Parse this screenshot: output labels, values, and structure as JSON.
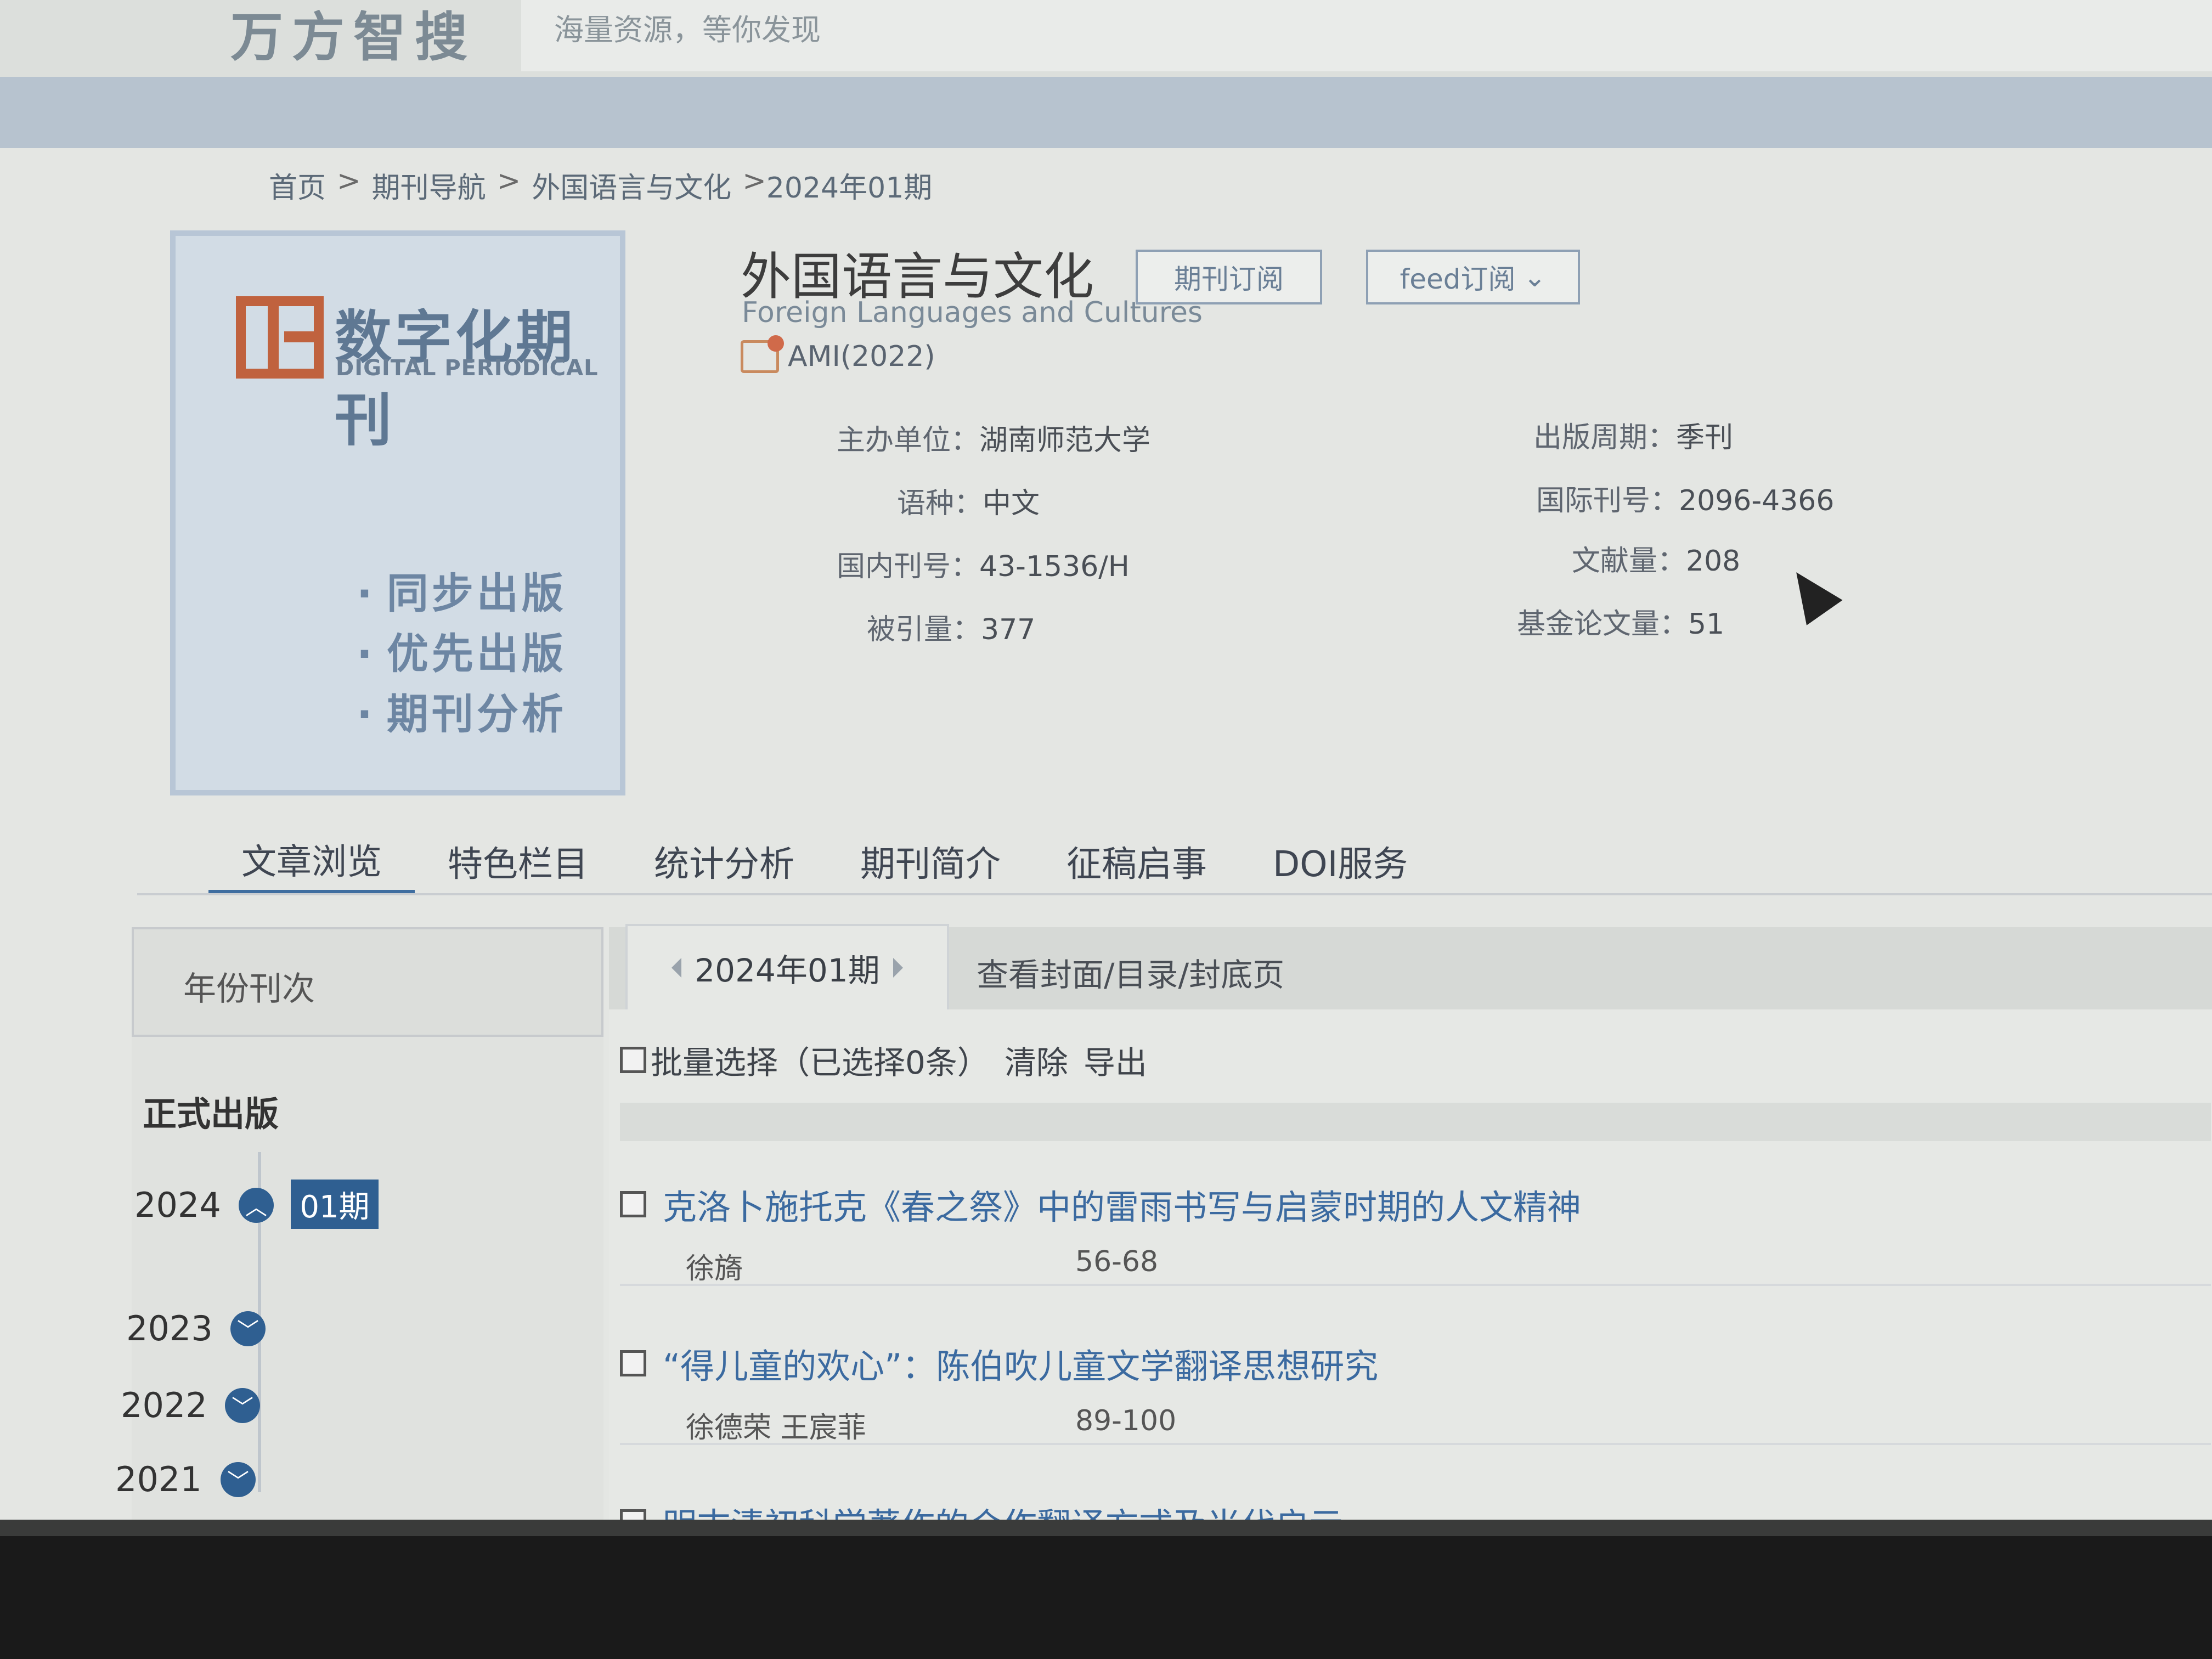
{
  "header": {
    "brand": "万方智搜",
    "slogan": "海量资源，等你发现"
  },
  "breadcrumb": {
    "items": [
      "首页",
      "期刊导航",
      "外国语言与文化",
      "2024年01期"
    ],
    "separator": ">"
  },
  "cover": {
    "title": "数字化期刊",
    "subtitle": "DIGITAL PERIODICAL",
    "features": [
      "同步出版",
      "优先出版",
      "期刊分析"
    ]
  },
  "journal": {
    "title": "外国语言与文化",
    "english_title": "Foreign Languages and Cultures",
    "ami": "AMI(2022)",
    "subscribe_label": "期刊订阅",
    "feed_label": "feed订阅",
    "info_left": [
      {
        "key": "主办单位：",
        "value": "湖南师范大学"
      },
      {
        "key": "语种：",
        "value": "中文"
      },
      {
        "key": "国内刊号：",
        "value": "43-1536/H"
      },
      {
        "key": "被引量：",
        "value": "377"
      }
    ],
    "info_right": [
      {
        "key": "出版周期：",
        "value": "季刊"
      },
      {
        "key": "国际刊号：",
        "value": "2096-4366"
      },
      {
        "key": "文献量：",
        "value": "208"
      },
      {
        "key": "基金论文量：",
        "value": "51"
      }
    ]
  },
  "tabs": [
    "文章浏览",
    "特色栏目",
    "统计分析",
    "期刊简介",
    "征稿启事",
    "DOI服务"
  ],
  "left_panel": {
    "heading": "年份刊次",
    "section": "正式出版",
    "years": [
      "2024",
      "2023",
      "2022",
      "2021"
    ],
    "current_issue": "01期"
  },
  "main_panel": {
    "issue_label": "2024年01期",
    "view_cover_label": "查看封面/目录/封底页",
    "batch_label": "批量选择（已选择0条）",
    "clear_label": "清除",
    "export_label": "导出",
    "articles": [
      {
        "title": "克洛卜施托克《春之祭》中的雷雨书写与启蒙时期的人文精神",
        "authors": "徐旖",
        "pages": "56-68"
      },
      {
        "title": "“得儿童的欢心”：陈伯吹儿童文学翻译思想研究",
        "authors": "徐德荣 王宸菲",
        "pages": "89-100"
      },
      {
        "title": "明末清初科学著作的合作翻译方式及当代启示",
        "authors": "",
        "pages": ""
      }
    ]
  },
  "colors": {
    "accent": "#2f5f91",
    "link": "#3b6aa0",
    "cover_logo": "#c0623e"
  }
}
